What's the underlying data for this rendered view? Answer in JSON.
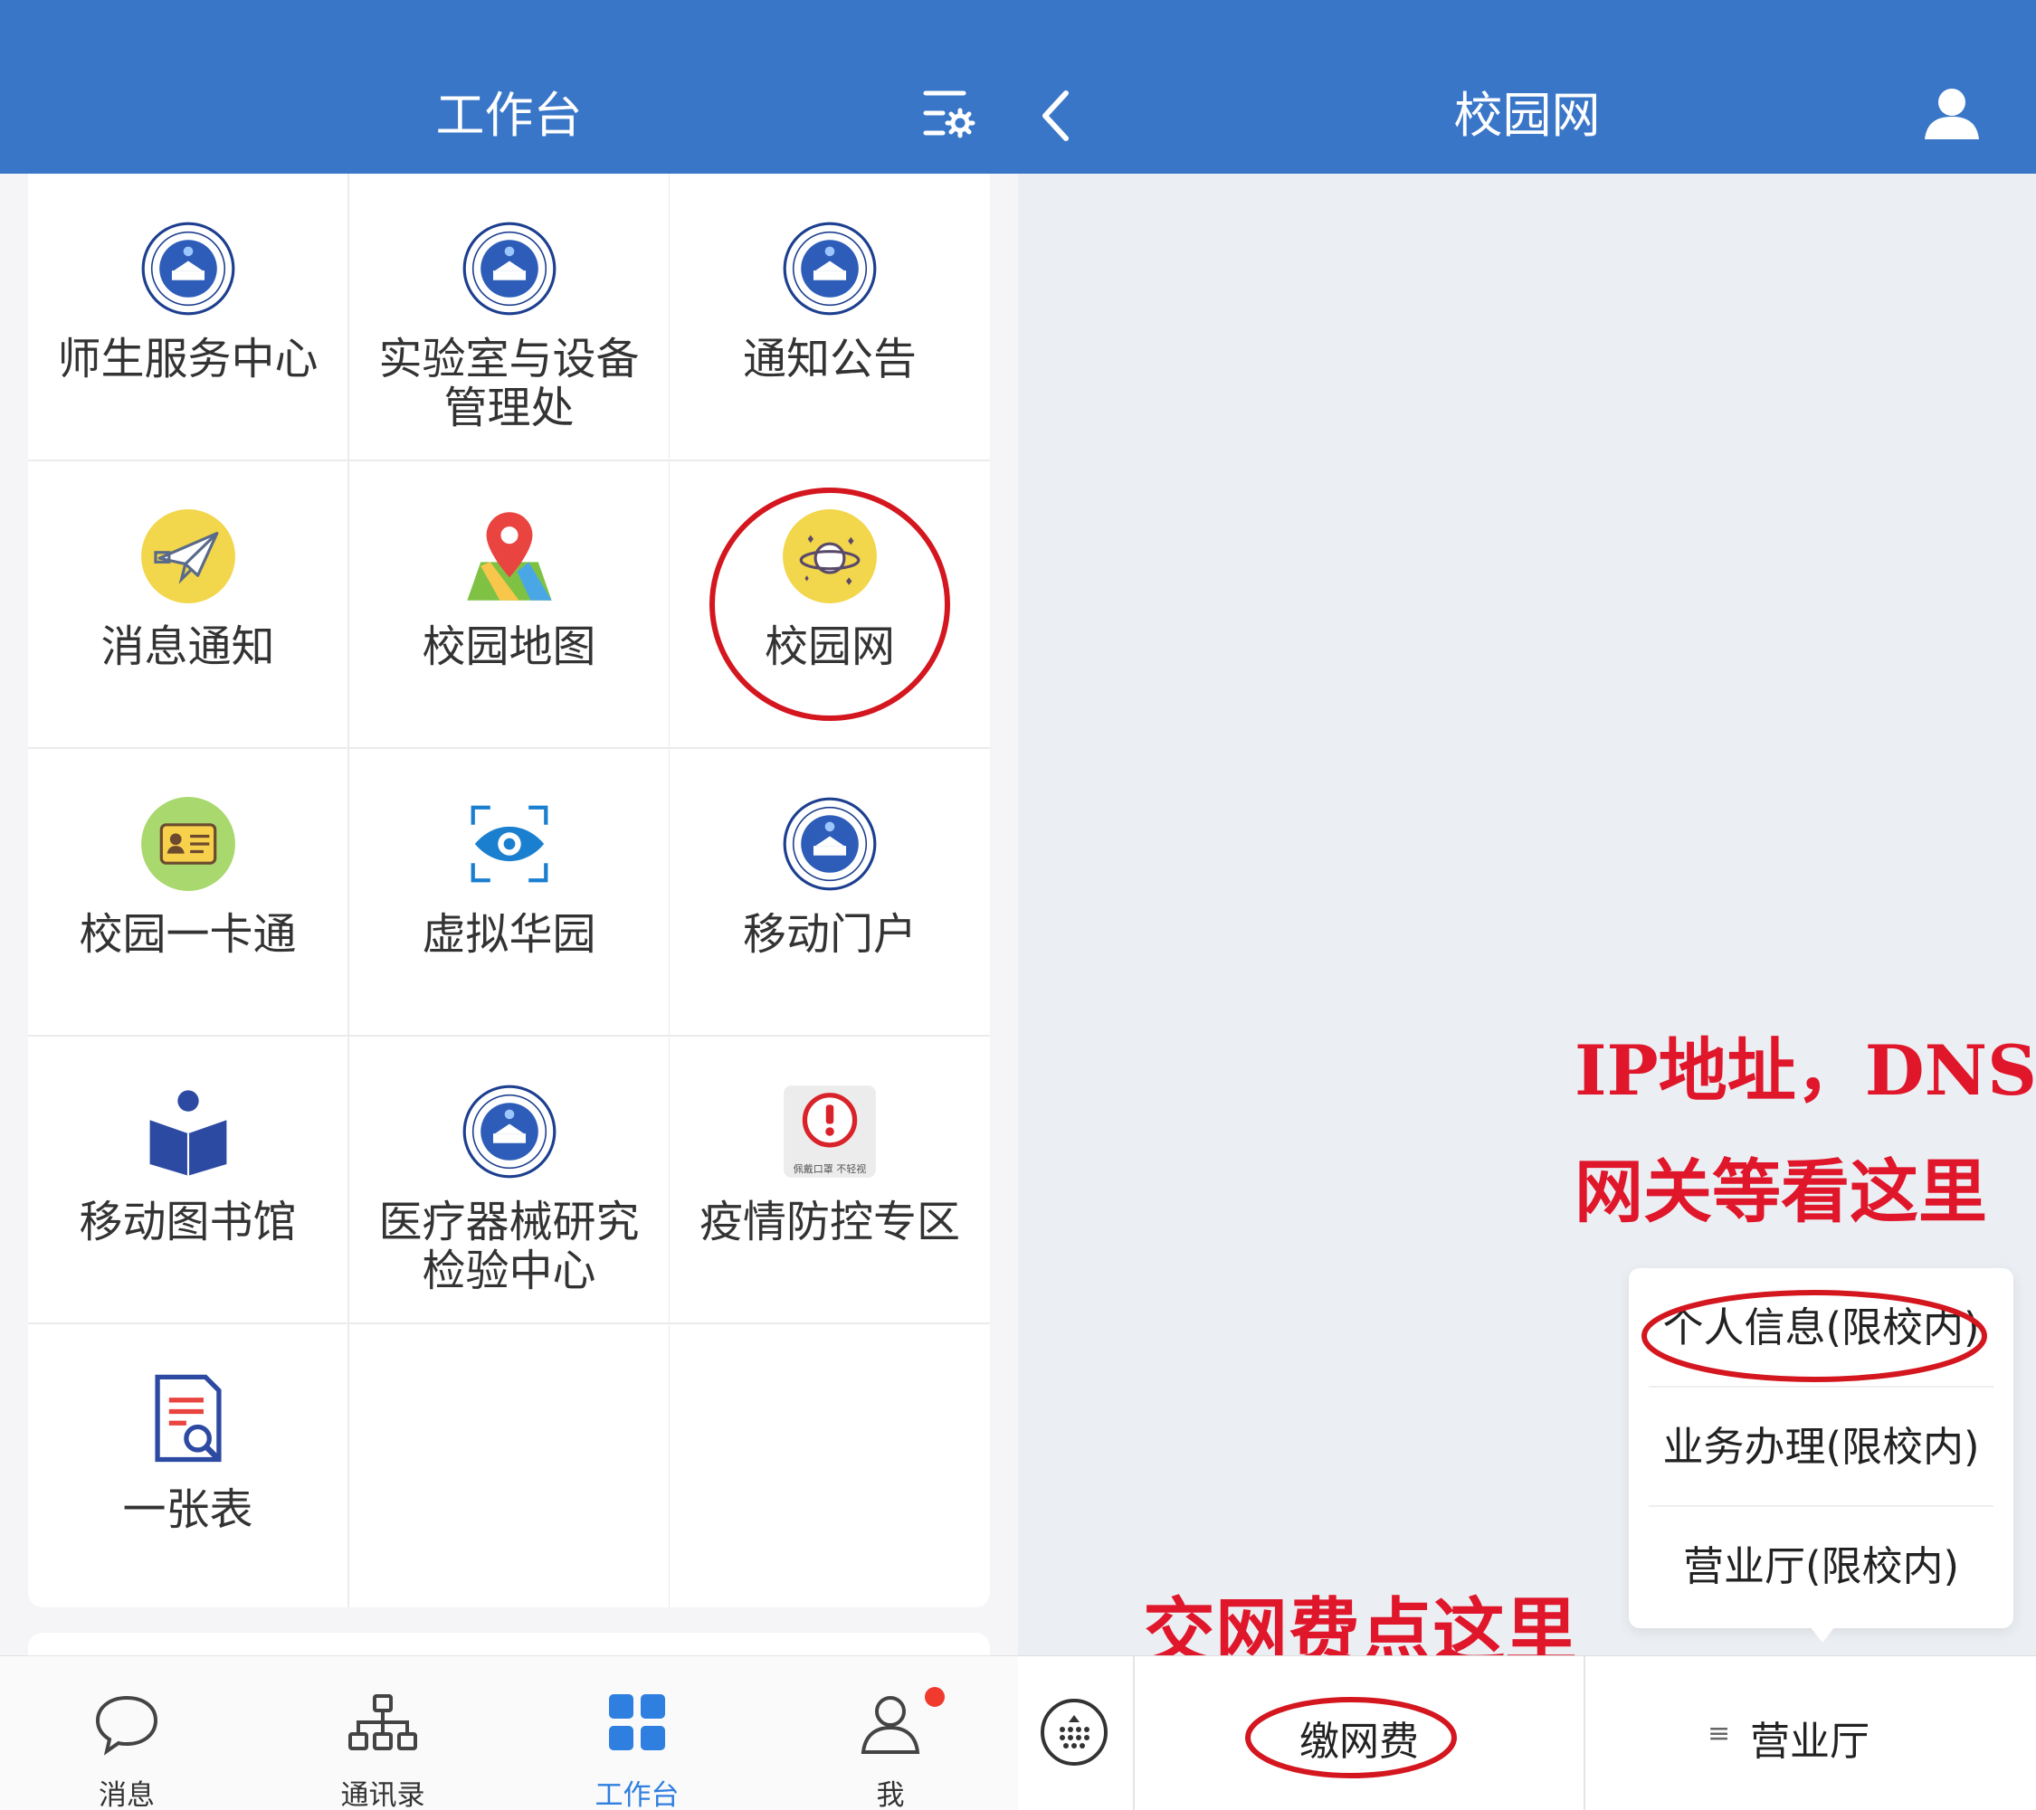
{
  "left": {
    "header": {
      "title": "工作台"
    },
    "apps": [
      {
        "label": "师生服务中心",
        "icon": "school-emblem-icon"
      },
      {
        "label": "实验室与设备\n管理处",
        "icon": "school-emblem-icon"
      },
      {
        "label": "通知公告",
        "icon": "school-emblem-icon"
      },
      {
        "label": "消息通知",
        "icon": "paper-plane-icon"
      },
      {
        "label": "校园地图",
        "icon": "map-pin-icon"
      },
      {
        "label": "校园网",
        "icon": "planet-icon"
      },
      {
        "label": "校园一卡通",
        "icon": "id-card-icon"
      },
      {
        "label": "虚拟华园",
        "icon": "eye-scan-icon"
      },
      {
        "label": "移动门户",
        "icon": "school-emblem-icon"
      },
      {
        "label": "移动图书馆",
        "icon": "reading-book-icon"
      },
      {
        "label": "医疗器械研究\n检验中心",
        "icon": "school-emblem-icon"
      },
      {
        "label": "疫情防控专区",
        "icon": "warning-sign-icon"
      },
      {
        "label": "一张表",
        "icon": "document-search-icon"
      }
    ],
    "warning_caption": "佩戴口罩 不轻视",
    "tabbar": [
      {
        "label": "消息",
        "icon": "chat-bubble-icon"
      },
      {
        "label": "通讯录",
        "icon": "org-chart-icon"
      },
      {
        "label": "工作台",
        "icon": "grid-icon",
        "active": true
      },
      {
        "label": "我",
        "icon": "person-icon"
      }
    ],
    "active_color": "#2f7fe0"
  },
  "right": {
    "header": {
      "title": "校园网"
    },
    "annotation_top_line1": "IP地址，DNS，",
    "annotation_top_line2": "网关等看这里",
    "annotation_bottom": "交网费点这里",
    "popup_menu": [
      "个人信息(限校内)",
      "业务办理(限校内)",
      "营业厅(限校内)"
    ],
    "bottom_bar": {
      "pay_label": "缴网费",
      "hall_label": "营业厅"
    }
  },
  "colors": {
    "header_blue": "#3a76c8",
    "annotation_red": "#e0162b"
  }
}
